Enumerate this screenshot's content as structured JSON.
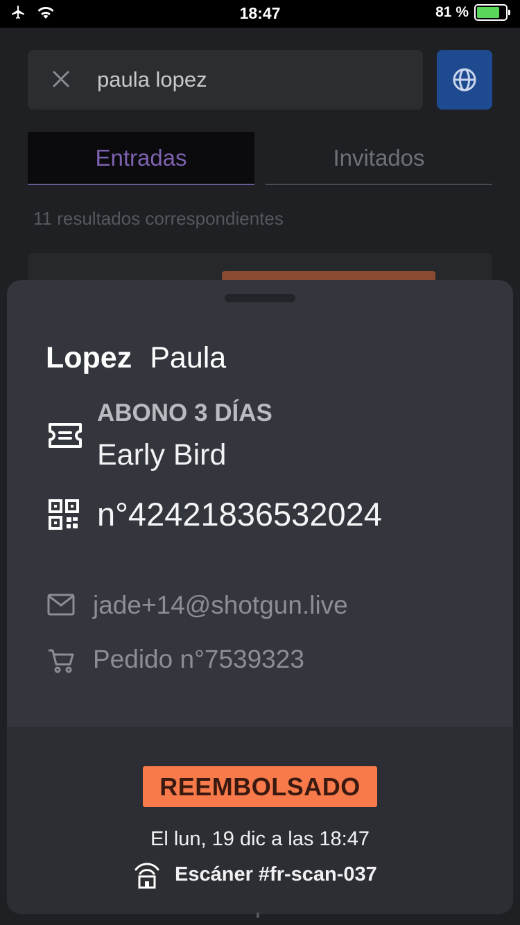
{
  "status_bar": {
    "time": "18:47",
    "battery_percent": "81 %",
    "battery_level": 0.81,
    "icons": [
      "airplane-icon",
      "wifi-icon",
      "battery-charging-icon"
    ]
  },
  "search": {
    "value": "paula lopez",
    "placeholder": ""
  },
  "tabs": [
    {
      "label": "Entradas",
      "active": true
    },
    {
      "label": "Invitados",
      "active": false
    }
  ],
  "results": {
    "count_text": "11 resultados correspondientes"
  },
  "ticket_sheet": {
    "last_name": "Lopez",
    "first_name": "Paula",
    "ticket_type": "ABONO 3 DÍAS",
    "ticket_name": "Early Bird",
    "ticket_number": "n°42421836532024",
    "email": "jade+14@shotgun.live",
    "order": "Pedido n°7539323",
    "status": "REEMBOLSADO",
    "status_date": "El lun, 19 dic a las 18:47",
    "scanner": "Escáner #fr-scan-037"
  },
  "colors": {
    "accent_tab": "#7d62b0",
    "globe_button": "#1e4a8f",
    "status_refunded": "#f8794a",
    "sheet_bg": "#33363c"
  }
}
